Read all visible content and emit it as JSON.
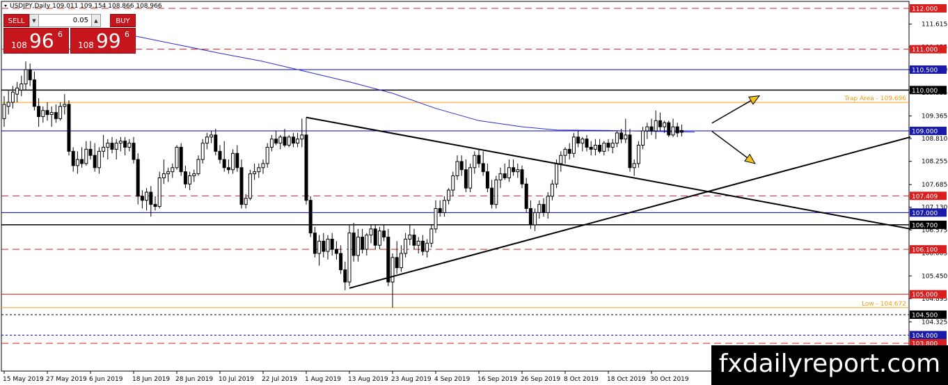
{
  "header": {
    "symbol_label": "USDJPY,Daily",
    "ohlc_label": "109.011 109.154 108.866 108.966"
  },
  "trade_panel": {
    "sell_label": "SELL",
    "buy_label": "BUY",
    "lot_value": "0.05",
    "down_icon": "triangle-down-icon",
    "up_icon": "triangle-up-icon",
    "sell_price": {
      "prefix": "108",
      "main": "96",
      "sup": "6"
    },
    "buy_price": {
      "prefix": "108",
      "main": "99",
      "sup": "6"
    }
  },
  "watermark": {
    "text": "fxdailyreport.com"
  },
  "colors": {
    "red_line": "#d81e1e",
    "blue_line": "#0000c0",
    "orange_line": "#f39c12",
    "black_line": "#000000",
    "ma_line": "#2b2bd6",
    "arrow_fill": "#f0c419",
    "candle": "#000000",
    "red_label": "#d81e1e",
    "blue_label": "#1a1aa8"
  },
  "chart_data": {
    "type": "candlestick",
    "symbol": "USDJPY",
    "timeframe": "Daily",
    "ylim": [
      103.6,
      112.15
    ],
    "y_ticks": [
      111.615,
      111.055,
      110.5,
      109.935,
      109.365,
      108.81,
      108.255,
      107.685,
      107.13,
      106.575,
      106.005,
      105.45,
      104.895,
      104.325
    ],
    "x_ticks": [
      "15 May 2019",
      "27 May 2019",
      "6 Jun 2019",
      "18 Jun 2019",
      "28 Jun 2019",
      "10 Jul 2019",
      "22 Jul 2019",
      "1 Aug 2019",
      "13 Aug 2019",
      "23 Aug 2019",
      "4 Sep 2019",
      "16 Sep 2019",
      "26 Sep 2019",
      "8 Oct 2019",
      "18 Oct 2019",
      "30 Oct 2019"
    ],
    "x_tick_index": [
      0,
      10,
      20,
      30,
      40,
      50,
      60,
      70,
      80,
      90,
      100,
      110,
      120,
      130,
      140,
      150
    ],
    "horizontal_levels": [
      {
        "price": 112.0,
        "label": "112.000",
        "style": "red-dashed"
      },
      {
        "price": 111.0,
        "label": "111.000",
        "style": "red-dashed"
      },
      {
        "price": 110.5,
        "label": "110.500",
        "style": "blue-solid"
      },
      {
        "price": 110.0,
        "label": "110.000",
        "style": "black-solid"
      },
      {
        "price": 109.696,
        "label": "",
        "style": "orange-solid",
        "annotation": "Trap Area - 109.696"
      },
      {
        "price": 109.0,
        "label": "109.000",
        "style": "blue-solid"
      },
      {
        "price": 107.409,
        "label": "107.409",
        "style": "red-dashed"
      },
      {
        "price": 107.0,
        "label": "107.000",
        "style": "blue-solid"
      },
      {
        "price": 106.7,
        "label": "106.700",
        "style": "black-solid"
      },
      {
        "price": 106.1,
        "label": "106.100",
        "style": "red-dashed"
      },
      {
        "price": 105.0,
        "label": "105.000",
        "style": "red-solid"
      },
      {
        "price": 104.672,
        "label": "",
        "style": "orange-solid",
        "annotation": "Low - 104.672"
      },
      {
        "price": 104.5,
        "label": "104.500",
        "style": "black-dashed"
      },
      {
        "price": 104.0,
        "label": "104.000",
        "style": "blue-dashed"
      },
      {
        "price": 103.8,
        "label": "103.800",
        "style": "red-dashed"
      }
    ],
    "trendlines": [
      {
        "name": "descending",
        "start": [
          70,
          109.33
        ],
        "end": [
          210,
          106.6
        ]
      },
      {
        "name": "ascending",
        "start": [
          80,
          105.15
        ],
        "end": [
          210,
          108.85
        ]
      }
    ],
    "arrows": [
      {
        "name": "up-arrow",
        "start": [
          164,
          109.19
        ],
        "end": [
          175,
          109.86
        ]
      },
      {
        "name": "down-arrow",
        "start": [
          164,
          108.99
        ],
        "end": [
          174,
          108.2
        ]
      }
    ],
    "moving_average": [
      [
        29,
        111.35
      ],
      [
        50,
        110.9
      ],
      [
        60,
        110.7
      ],
      [
        70,
        110.45
      ],
      [
        80,
        110.2
      ],
      [
        90,
        109.92
      ],
      [
        100,
        109.55
      ],
      [
        110,
        109.25
      ],
      [
        120,
        109.1
      ],
      [
        128,
        109.02
      ],
      [
        140,
        109.01
      ],
      [
        150,
        108.99
      ],
      [
        160,
        108.97
      ]
    ],
    "candles": [
      [
        0,
        109.3,
        109.85,
        109.1,
        109.65
      ],
      [
        1,
        109.6,
        110.0,
        109.4,
        109.7
      ],
      [
        2,
        109.7,
        110.1,
        109.55,
        109.95
      ],
      [
        3,
        109.9,
        110.2,
        109.7,
        110.05
      ],
      [
        4,
        110.0,
        110.35,
        109.85,
        110.15
      ],
      [
        5,
        110.15,
        110.7,
        110.0,
        110.5
      ],
      [
        6,
        110.5,
        110.65,
        110.1,
        110.25
      ],
      [
        7,
        110.25,
        110.45,
        109.5,
        109.6
      ],
      [
        8,
        109.6,
        109.8,
        109.1,
        109.35
      ],
      [
        9,
        109.35,
        109.6,
        109.2,
        109.5
      ],
      [
        10,
        109.5,
        109.7,
        109.25,
        109.4
      ],
      [
        11,
        109.4,
        109.6,
        109.1,
        109.45
      ],
      [
        12,
        109.45,
        109.65,
        109.2,
        109.3
      ],
      [
        13,
        109.3,
        109.7,
        109.25,
        109.6
      ],
      [
        14,
        109.6,
        109.9,
        109.4,
        109.65
      ],
      [
        15,
        109.65,
        109.75,
        108.4,
        108.5
      ],
      [
        16,
        108.5,
        108.6,
        108.0,
        108.15
      ],
      [
        17,
        108.15,
        108.5,
        107.95,
        108.3
      ],
      [
        18,
        108.3,
        108.6,
        108.1,
        108.2
      ],
      [
        19,
        108.2,
        108.75,
        108.15,
        108.55
      ],
      [
        20,
        108.55,
        108.75,
        108.3,
        108.4
      ],
      [
        21,
        108.4,
        108.7,
        108.0,
        108.1
      ],
      [
        22,
        108.1,
        108.6,
        107.95,
        108.5
      ],
      [
        23,
        108.5,
        108.9,
        108.35,
        108.6
      ],
      [
        24,
        108.6,
        108.8,
        108.3,
        108.7
      ],
      [
        25,
        108.7,
        108.85,
        108.45,
        108.55
      ],
      [
        26,
        108.55,
        108.8,
        108.3,
        108.7
      ],
      [
        27,
        108.7,
        108.85,
        108.5,
        108.75
      ],
      [
        28,
        108.75,
        108.85,
        108.4,
        108.6
      ],
      [
        29,
        108.6,
        108.8,
        108.5,
        108.7
      ],
      [
        30,
        108.7,
        108.85,
        108.2,
        108.3
      ],
      [
        31,
        108.3,
        108.45,
        107.2,
        107.4
      ],
      [
        32,
        107.4,
        107.55,
        107.1,
        107.3
      ],
      [
        33,
        107.3,
        107.6,
        107.05,
        107.5
      ],
      [
        34,
        107.5,
        107.65,
        106.9,
        107.2
      ],
      [
        35,
        107.2,
        107.4,
        107.05,
        107.15
      ],
      [
        36,
        107.15,
        108.0,
        107.1,
        107.85
      ],
      [
        37,
        107.85,
        108.3,
        107.7,
        107.95
      ],
      [
        38,
        107.95,
        108.1,
        107.75,
        108.0
      ],
      [
        39,
        108.0,
        108.2,
        107.85,
        108.1
      ],
      [
        40,
        108.1,
        108.65,
        108.05,
        108.6
      ],
      [
        41,
        108.6,
        108.7,
        107.9,
        108.0
      ],
      [
        42,
        108.0,
        108.15,
        107.6,
        107.7
      ],
      [
        43,
        107.7,
        108.0,
        107.55,
        107.9
      ],
      [
        44,
        107.9,
        108.05,
        107.75,
        107.95
      ],
      [
        45,
        107.95,
        108.4,
        107.9,
        108.3
      ],
      [
        46,
        108.3,
        108.8,
        108.2,
        108.7
      ],
      [
        47,
        108.7,
        108.95,
        108.55,
        108.85
      ],
      [
        48,
        108.85,
        109.0,
        108.7,
        108.9
      ],
      [
        49,
        108.9,
        109.05,
        108.4,
        108.5
      ],
      [
        50,
        108.5,
        108.65,
        108.2,
        108.3
      ],
      [
        51,
        108.3,
        108.75,
        108.0,
        108.1
      ],
      [
        52,
        108.1,
        108.3,
        107.95,
        108.05
      ],
      [
        53,
        108.05,
        108.55,
        107.95,
        108.45
      ],
      [
        54,
        108.45,
        108.65,
        108.0,
        108.1
      ],
      [
        55,
        108.1,
        108.3,
        107.1,
        107.2
      ],
      [
        56,
        107.2,
        107.45,
        107.1,
        107.35
      ],
      [
        57,
        107.35,
        108.05,
        107.3,
        107.95
      ],
      [
        58,
        107.95,
        108.2,
        107.8,
        108.0
      ],
      [
        59,
        108.0,
        108.2,
        107.85,
        108.1
      ],
      [
        60,
        108.1,
        108.3,
        107.95,
        108.2
      ],
      [
        61,
        108.2,
        108.7,
        108.1,
        108.6
      ],
      [
        62,
        108.6,
        108.9,
        108.5,
        108.8
      ],
      [
        63,
        108.8,
        109.0,
        108.65,
        108.7
      ],
      [
        64,
        108.7,
        108.9,
        108.55,
        108.85
      ],
      [
        65,
        108.85,
        109.05,
        108.6,
        108.65
      ],
      [
        66,
        108.65,
        108.9,
        108.6,
        108.85
      ],
      [
        67,
        108.85,
        108.95,
        108.6,
        108.7
      ],
      [
        68,
        108.7,
        108.95,
        108.6,
        108.8
      ],
      [
        69,
        108.8,
        109.3,
        108.6,
        108.9
      ],
      [
        70,
        108.9,
        109.33,
        107.2,
        107.3
      ],
      [
        71,
        107.3,
        107.4,
        106.4,
        106.5
      ],
      [
        72,
        106.5,
        106.65,
        105.9,
        106.0
      ],
      [
        73,
        106.0,
        106.45,
        105.7,
        106.3
      ],
      [
        74,
        106.3,
        106.5,
        105.9,
        106.05
      ],
      [
        75,
        106.05,
        106.45,
        105.85,
        106.35
      ],
      [
        76,
        106.35,
        106.5,
        105.95,
        106.1
      ],
      [
        77,
        106.1,
        106.3,
        105.85,
        106.0
      ],
      [
        78,
        106.0,
        106.2,
        105.5,
        105.6
      ],
      [
        79,
        105.6,
        105.8,
        105.1,
        105.3
      ],
      [
        80,
        105.3,
        106.7,
        105.2,
        106.5
      ],
      [
        81,
        106.5,
        106.75,
        105.8,
        105.95
      ],
      [
        82,
        105.95,
        106.6,
        105.8,
        106.4
      ],
      [
        83,
        106.4,
        106.6,
        106.0,
        106.1
      ],
      [
        84,
        106.1,
        106.5,
        105.95,
        106.45
      ],
      [
        85,
        106.45,
        106.7,
        106.25,
        106.6
      ],
      [
        86,
        106.6,
        106.7,
        106.1,
        106.2
      ],
      [
        87,
        106.2,
        106.65,
        106.1,
        106.55
      ],
      [
        88,
        106.55,
        106.7,
        106.3,
        106.4
      ],
      [
        89,
        106.4,
        106.6,
        105.2,
        105.3
      ],
      [
        90,
        105.3,
        106.0,
        104.672,
        105.9
      ],
      [
        91,
        105.9,
        106.3,
        105.5,
        105.65
      ],
      [
        92,
        105.65,
        106.2,
        105.55,
        106.0
      ],
      [
        93,
        106.0,
        106.5,
        105.9,
        106.35
      ],
      [
        94,
        106.35,
        106.7,
        106.2,
        106.45
      ],
      [
        95,
        106.45,
        106.6,
        106.1,
        106.2
      ],
      [
        96,
        106.2,
        106.4,
        106.0,
        106.3
      ],
      [
        97,
        106.3,
        106.45,
        105.95,
        106.05
      ],
      [
        98,
        106.05,
        106.35,
        105.9,
        106.25
      ],
      [
        99,
        106.25,
        106.7,
        106.15,
        106.6
      ],
      [
        100,
        106.6,
        107.3,
        106.5,
        107.1
      ],
      [
        101,
        107.1,
        107.3,
        106.9,
        107.0
      ],
      [
        102,
        107.0,
        107.4,
        106.9,
        107.3
      ],
      [
        103,
        107.3,
        107.6,
        107.2,
        107.55
      ],
      [
        104,
        107.55,
        108.0,
        107.4,
        107.9
      ],
      [
        105,
        107.9,
        108.4,
        107.8,
        108.25
      ],
      [
        106,
        108.25,
        108.4,
        107.9,
        108.05
      ],
      [
        107,
        108.05,
        108.3,
        107.5,
        107.6
      ],
      [
        108,
        107.6,
        108.2,
        107.5,
        108.1
      ],
      [
        109,
        108.1,
        108.5,
        107.95,
        108.4
      ],
      [
        110,
        108.4,
        108.55,
        108.1,
        108.2
      ],
      [
        111,
        108.2,
        108.5,
        107.9,
        108.0
      ],
      [
        112,
        108.0,
        108.2,
        107.5,
        107.6
      ],
      [
        113,
        107.6,
        107.8,
        107.1,
        107.2
      ],
      [
        114,
        107.2,
        107.9,
        107.1,
        107.8
      ],
      [
        115,
        107.8,
        108.1,
        107.6,
        107.95
      ],
      [
        116,
        107.95,
        108.2,
        107.8,
        107.85
      ],
      [
        117,
        107.85,
        108.3,
        107.75,
        108.1
      ],
      [
        118,
        108.1,
        108.3,
        107.9,
        108.0
      ],
      [
        119,
        108.0,
        108.2,
        107.85,
        108.05
      ],
      [
        120,
        108.05,
        108.15,
        107.6,
        107.7
      ],
      [
        121,
        107.7,
        107.85,
        107.0,
        107.1
      ],
      [
        122,
        107.1,
        107.3,
        106.6,
        106.7
      ],
      [
        123,
        106.7,
        107.1,
        106.55,
        107.0
      ],
      [
        124,
        107.0,
        107.3,
        106.85,
        107.2
      ],
      [
        125,
        107.2,
        107.35,
        106.9,
        107.0
      ],
      [
        126,
        107.0,
        107.5,
        106.85,
        107.4
      ],
      [
        127,
        107.4,
        107.8,
        107.3,
        107.7
      ],
      [
        128,
        107.7,
        108.3,
        107.6,
        108.2
      ],
      [
        129,
        108.2,
        108.5,
        108.0,
        108.4
      ],
      [
        130,
        108.4,
        108.6,
        108.2,
        108.55
      ],
      [
        131,
        108.55,
        108.7,
        108.3,
        108.45
      ],
      [
        132,
        108.45,
        108.95,
        108.35,
        108.85
      ],
      [
        133,
        108.85,
        109.0,
        108.6,
        108.7
      ],
      [
        134,
        108.7,
        108.85,
        108.5,
        108.8
      ],
      [
        135,
        108.8,
        108.9,
        108.5,
        108.6
      ],
      [
        136,
        108.6,
        108.75,
        108.4,
        108.55
      ],
      [
        137,
        108.55,
        108.8,
        108.4,
        108.65
      ],
      [
        138,
        108.65,
        108.8,
        108.45,
        108.5
      ],
      [
        139,
        108.5,
        108.75,
        108.4,
        108.7
      ],
      [
        140,
        108.7,
        108.8,
        108.5,
        108.6
      ],
      [
        141,
        108.6,
        108.8,
        108.45,
        108.7
      ],
      [
        142,
        108.7,
        109.0,
        108.6,
        108.95
      ],
      [
        143,
        108.95,
        109.05,
        108.7,
        108.8
      ],
      [
        144,
        108.8,
        109.3,
        108.7,
        108.9
      ],
      [
        145,
        108.9,
        109.05,
        108.0,
        108.1
      ],
      [
        146,
        108.1,
        108.3,
        107.9,
        108.2
      ],
      [
        147,
        108.2,
        108.75,
        108.1,
        108.65
      ],
      [
        148,
        108.65,
        109.1,
        108.55,
        109.0
      ],
      [
        149,
        109.0,
        109.2,
        108.8,
        109.1
      ],
      [
        150,
        109.1,
        109.3,
        108.9,
        109.0
      ],
      [
        151,
        109.0,
        109.5,
        108.8,
        109.25
      ],
      [
        152,
        109.25,
        109.45,
        109.0,
        109.1
      ],
      [
        153,
        109.1,
        109.25,
        108.95,
        109.2
      ],
      [
        154,
        109.2,
        109.25,
        108.85,
        108.9
      ],
      [
        155,
        108.9,
        109.3,
        108.85,
        109.1
      ],
      [
        156,
        109.1,
        109.2,
        108.85,
        108.95
      ],
      [
        157,
        109.011,
        109.154,
        108.866,
        108.966
      ]
    ]
  }
}
